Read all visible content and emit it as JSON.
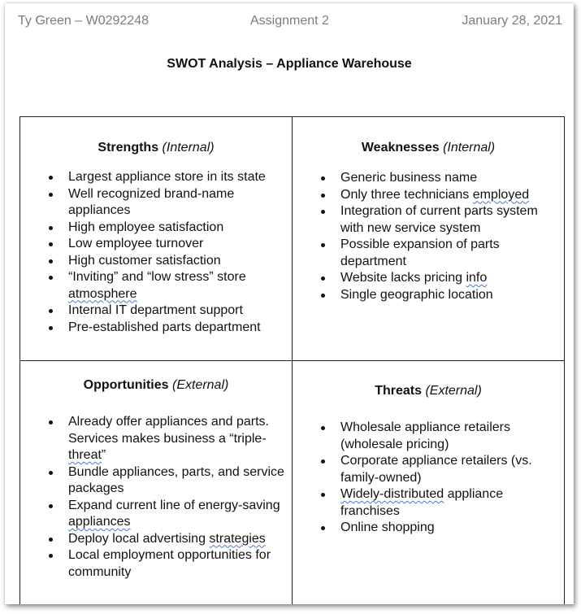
{
  "header": {
    "author": "Ty Green – W0292248",
    "assignment": "Assignment 2",
    "date": "January 28, 2021"
  },
  "title": "SWOT Analysis – Appliance Warehouse",
  "quadrants": {
    "strengths": {
      "title": "Strengths",
      "qualifier": "(Internal)",
      "items": [
        "Largest appliance store in its state",
        "Well recognized brand-name appliances",
        "High employee satisfaction",
        "Low employee turnover",
        "High customer satisfaction",
        "“Inviting” and “low stress” store atmosphere",
        "Internal IT department support",
        "Pre-established parts department"
      ]
    },
    "weaknesses": {
      "title": "Weaknesses",
      "qualifier": "(Internal)",
      "items": [
        "Generic business name",
        "Only three technicians employed",
        "Integration of current parts system with new service system",
        "Possible expansion of parts department",
        "Website lacks pricing info",
        "Single geographic location"
      ]
    },
    "opportunities": {
      "title": "Opportunities",
      "qualifier": "(External)",
      "items": [
        "Already offer appliances and parts. Services makes business a “triple-threat”",
        "Bundle appliances, parts, and service packages",
        "Expand current line of energy-saving appliances",
        "Deploy local advertising strategies",
        "Local employment opportunities for community"
      ]
    },
    "threats": {
      "title": "Threats",
      "qualifier": "(External)",
      "items": [
        "Wholesale appliance retailers (wholesale pricing)",
        "Corporate appliance retailers (vs. family-owned)",
        "Widely-distributed appliance franchises",
        "Online shopping"
      ]
    }
  }
}
